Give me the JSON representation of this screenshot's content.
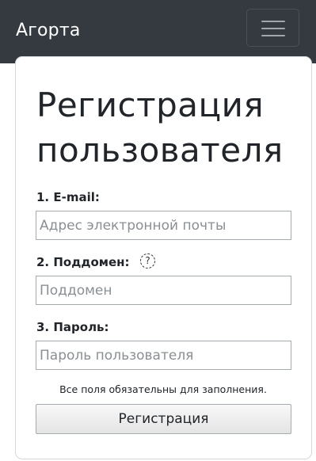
{
  "navbar": {
    "brand": "Агорта",
    "toggler_icon": "hamburger-menu-icon",
    "background_color": "#343a40"
  },
  "form": {
    "title": "Регистрация пользователя",
    "email": {
      "label": "1. E-mail:",
      "placeholder": "Адрес электронной почты",
      "value": ""
    },
    "subdomain": {
      "label": "2. Поддомен:",
      "help_icon_glyph": "?",
      "help_icon": "question-circle-icon",
      "placeholder": "Поддомен",
      "value": ""
    },
    "password": {
      "label": "3. Пароль:",
      "placeholder": "Пароль пользователя",
      "value": ""
    },
    "note": "Все поля обязательны для заполнения.",
    "submit_label": "Регистрация"
  }
}
